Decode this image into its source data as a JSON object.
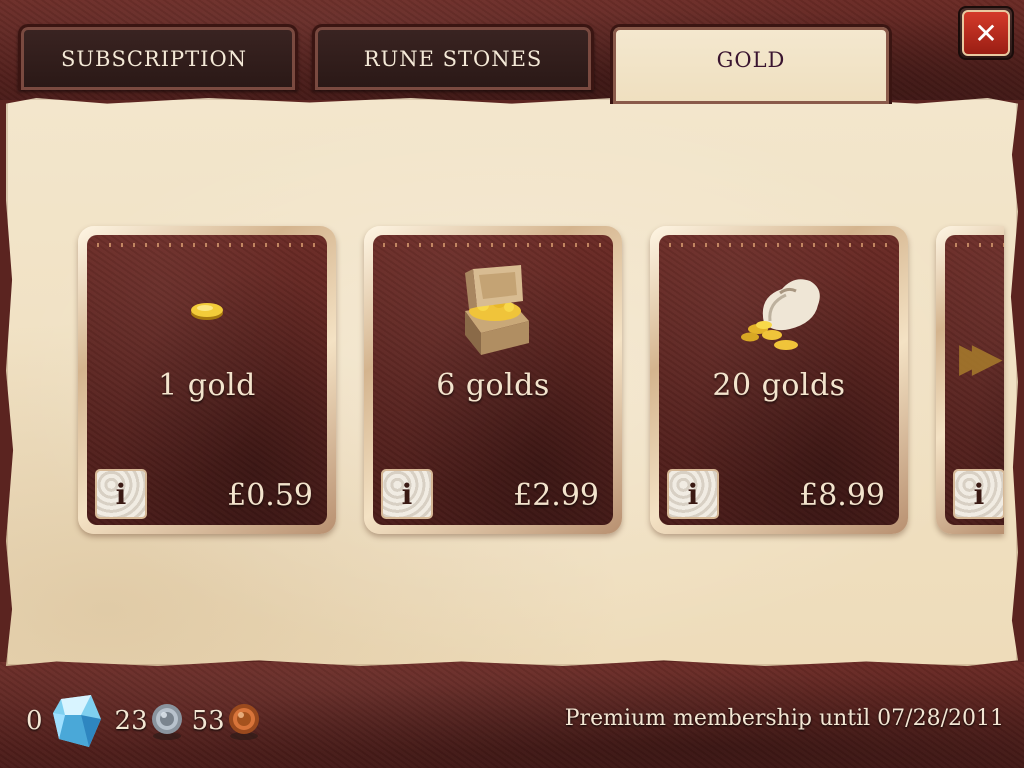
{
  "tabs": [
    {
      "label": "SUBSCRIPTION",
      "active": false
    },
    {
      "label": "RUNE STONES",
      "active": false
    },
    {
      "label": "GOLD",
      "active": true
    }
  ],
  "close_icon": "close-x-icon",
  "products": [
    {
      "label": "1 gold",
      "price": "£0.59",
      "icon": "gold-coin-icon"
    },
    {
      "label": "6 golds",
      "price": "£2.99",
      "icon": "gold-chest-icon"
    },
    {
      "label": "20 golds",
      "price": "£8.99",
      "icon": "gold-sack-icon"
    },
    {
      "label": "",
      "price": "",
      "icon": "next-arrow-icon"
    }
  ],
  "info_label": "i",
  "currency": {
    "gems": "0",
    "silver": "23",
    "bronze": "53"
  },
  "premium_text": "Premium membership until 07/28/2011",
  "colors": {
    "leather": "#5b2420",
    "parchment": "#f3e6cc",
    "active_tab_text": "#3a1530",
    "close_red": "#c83024"
  }
}
